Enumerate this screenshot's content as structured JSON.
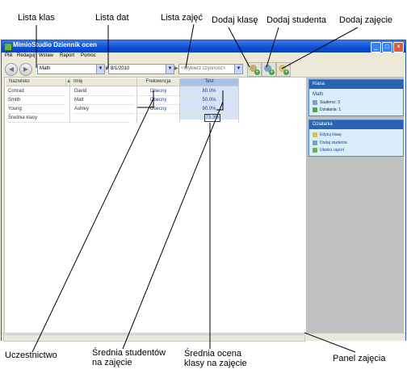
{
  "callouts": {
    "class_list": "Lista klas",
    "date_list": "Lista dat",
    "activity_list": "Lista zajęć",
    "add_class": "Dodaj klasę",
    "add_student": "Dodaj studenta",
    "add_activity": "Dodaj zajęcie",
    "attendance": "Uczestnictwo",
    "student_avg": "Średnia studentów na zajęcie",
    "class_avg": "Średnia ocena klasy na zajęcie",
    "activity_panel": "Panel zajęcia"
  },
  "window": {
    "title": "MimioStudio Dziennik ocen",
    "menu": [
      "Plik",
      "Redaguj",
      "Wstaw",
      "Raport",
      "Pomoc"
    ]
  },
  "toolbar": {
    "class_value": "Math",
    "date_value": "8/1/2010",
    "activity_value": "<Wybierz czynność>"
  },
  "grid": {
    "headers": {
      "surname": "Nazwisko",
      "firstname": "Imię",
      "attendance": "Frekwencja",
      "test": "Test"
    },
    "rows": [
      {
        "surname": "Conrad",
        "firstname": "David",
        "attendance": "Obecny",
        "test": "80.0%"
      },
      {
        "surname": "Smith",
        "firstname": "Matt",
        "attendance": "Obecny",
        "test": "50.0%"
      },
      {
        "surname": "Young",
        "firstname": "Ashley",
        "attendance": "Obecny",
        "test": "90.0%"
      }
    ],
    "average_label": "Średnia klasy",
    "average_value": "73.3%"
  },
  "side": {
    "class_header": "Klasa",
    "class_name": "Math",
    "students": "Studenci: 3",
    "activities": "Działania: 1",
    "actions_header": "Działania",
    "actions": [
      "Edytuj klasę",
      "Dodaj studenta",
      "Utwórz raport"
    ]
  }
}
